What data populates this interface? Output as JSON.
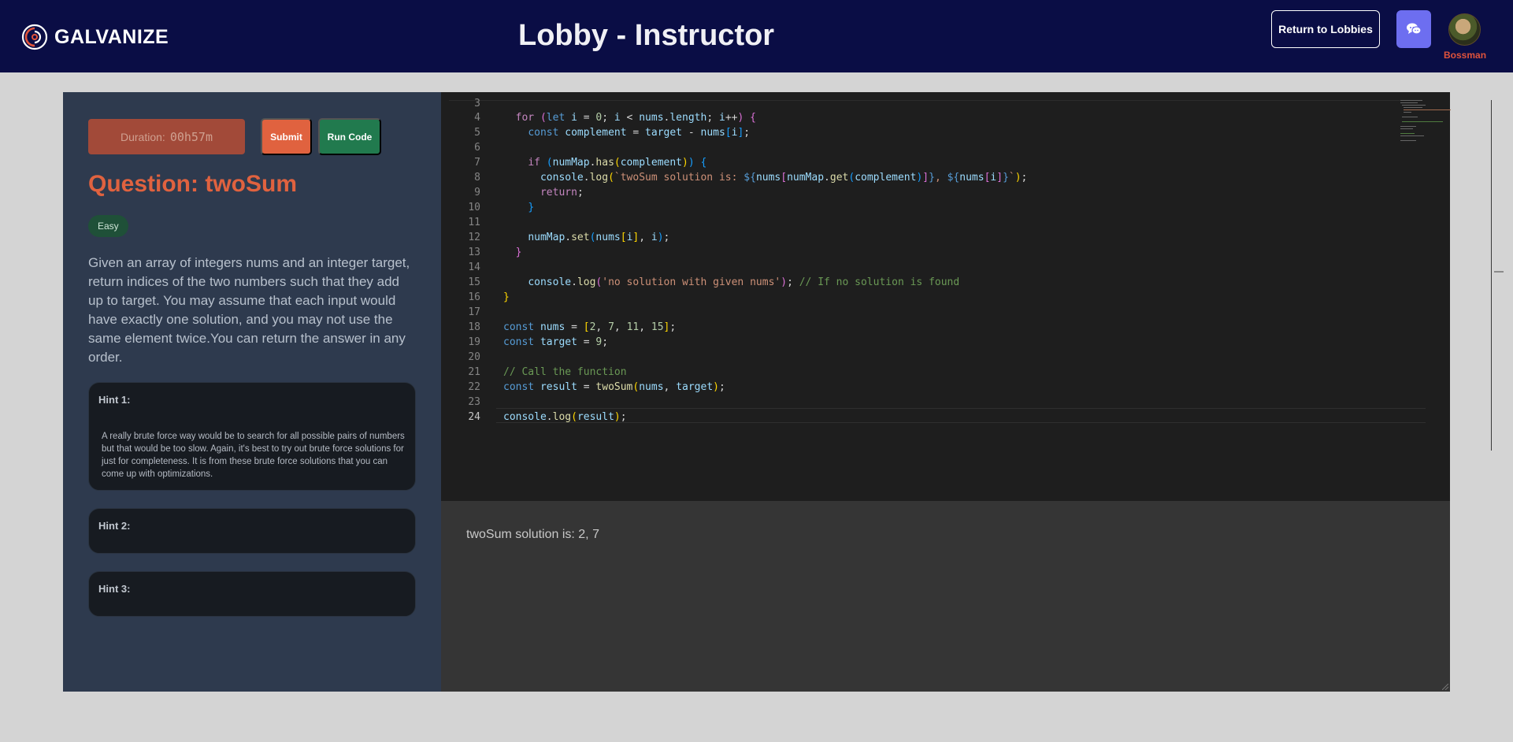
{
  "header": {
    "brand": "GALVANIZE",
    "title": "Lobby - Instructor",
    "return_button": "Return to Lobbies",
    "chat_icon": "chat-bubbles-icon",
    "username": "Bossman",
    "colors": {
      "bar": "#0a0d45",
      "accent": "#e0533b",
      "chat_button": "#6d6ef0"
    }
  },
  "question": {
    "duration_label": "Duration:",
    "duration_value": "00h57m",
    "submit_label": "Submit",
    "run_label": "Run Code",
    "title": "Question: twoSum",
    "difficulty": "Easy",
    "description": "Given an array of integers nums and an integer target, return indices of the two numbers such that they add up to target. You may assume that each input would have exactly one solution, and you may not use the same element twice.You can return the answer in any order.",
    "hints": [
      {
        "title": "Hint 1:",
        "body": "A really brute force way would be to search for all possible pairs of numbers but that would be too slow. Again, it's best to try out brute force solutions for just for completeness. It is from these brute force solutions that you can come up with optimizations."
      },
      {
        "title": "Hint 2:",
        "body": ""
      },
      {
        "title": "Hint 3:",
        "body": ""
      }
    ]
  },
  "editor": {
    "line_numbers": [
      "3",
      "4",
      "5",
      "6",
      "7",
      "8",
      "9",
      "10",
      "11",
      "12",
      "13",
      "14",
      "15",
      "16",
      "17",
      "18",
      "19",
      "20",
      "21",
      "22",
      "23",
      "24"
    ],
    "current_line": "24"
  },
  "output": {
    "text": "twoSum solution is: 2, 7"
  }
}
